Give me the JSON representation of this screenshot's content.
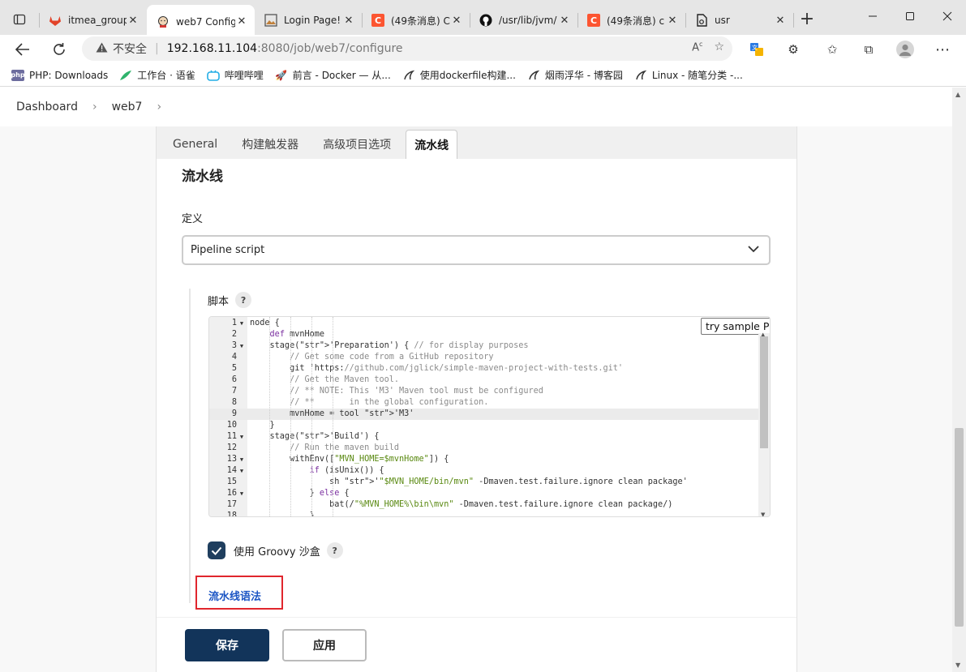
{
  "browser": {
    "tabs": [
      {
        "title": "itmea_group",
        "favicon": "gitlab-icon",
        "color": "#e24329"
      },
      {
        "title": "web7 Config",
        "favicon": "jenkins-icon",
        "color": "#d33833",
        "active": true
      },
      {
        "title": "Login Page!",
        "favicon": "image-icon",
        "color": "#666666"
      },
      {
        "title": "(49条消息) C",
        "favicon": "csdn-icon",
        "color": "#fc5531"
      },
      {
        "title": "/usr/lib/jvm/",
        "favicon": "github-icon",
        "color": "#111111"
      },
      {
        "title": "(49条消息) c",
        "favicon": "csdn-icon",
        "color": "#fc5531"
      },
      {
        "title": "usr",
        "favicon": "file-icon",
        "color": "#222222"
      }
    ],
    "address": {
      "insecure_label": "不安全",
      "host": "192.168.11.104",
      "path": ":8080/job/web7/configure"
    },
    "bookmarks": [
      {
        "label": "PHP: Downloads",
        "icon": "php-icon"
      },
      {
        "label": "工作台 · 语雀",
        "icon": "yuque-icon"
      },
      {
        "label": "哔哩哔哩",
        "icon": "bilibili-icon"
      },
      {
        "label": "前言 - Docker — 从...",
        "icon": "rocket-icon"
      },
      {
        "label": "使用dockerfile构建...",
        "icon": "cnblogs-icon"
      },
      {
        "label": "烟雨浮华 - 博客园",
        "icon": "cnblogs-icon"
      },
      {
        "label": "Linux - 随笔分类 -...",
        "icon": "cnblogs-icon"
      }
    ]
  },
  "breadcrumb": {
    "items": [
      "Dashboard",
      "web7"
    ]
  },
  "config_tabs": [
    "General",
    "构建触发器",
    "高级项目选项",
    "流水线"
  ],
  "section": {
    "title": "流水线",
    "definition_label": "定义",
    "definition_value": "Pipeline script",
    "script_label": "脚本",
    "help": "?",
    "sample_select": "try sample Pipeline...",
    "groovy_sandbox_label": "使用 Groovy 沙盒",
    "pipeline_syntax_link": "流水线语法"
  },
  "code_lines": [
    {
      "n": "1",
      "t": "node {"
    },
    {
      "n": "2",
      "t": "    def mvnHome"
    },
    {
      "n": "3",
      "t": "    stage('Preparation') { // for display purposes"
    },
    {
      "n": "4",
      "t": "        // Get some code from a GitHub repository"
    },
    {
      "n": "5",
      "t": "        git 'https://github.com/jglick/simple-maven-project-with-tests.git'"
    },
    {
      "n": "6",
      "t": "        // Get the Maven tool."
    },
    {
      "n": "7",
      "t": "        // ** NOTE: This 'M3' Maven tool must be configured"
    },
    {
      "n": "8",
      "t": "        // **       in the global configuration."
    },
    {
      "n": "9",
      "t": "        mvnHome = tool 'M3'"
    },
    {
      "n": "10",
      "t": "    }"
    },
    {
      "n": "11",
      "t": "    stage('Build') {"
    },
    {
      "n": "12",
      "t": "        // Run the maven build"
    },
    {
      "n": "13",
      "t": "        withEnv([\"MVN_HOME=$mvnHome\"]) {"
    },
    {
      "n": "14",
      "t": "            if (isUnix()) {"
    },
    {
      "n": "15",
      "t": "                sh '\"$MVN_HOME/bin/mvn\" -Dmaven.test.failure.ignore clean package'"
    },
    {
      "n": "16",
      "t": "            } else {"
    },
    {
      "n": "17",
      "t": "                bat(/\"%MVN_HOME%\\bin\\mvn\" -Dmaven.test.failure.ignore clean package/)"
    },
    {
      "n": "18",
      "t": "            }"
    }
  ],
  "buttons": {
    "save": "保存",
    "apply": "应用"
  },
  "colors": {
    "primary": "#12345a",
    "link": "#1b55c4",
    "highlight_box": "#e0262d"
  }
}
